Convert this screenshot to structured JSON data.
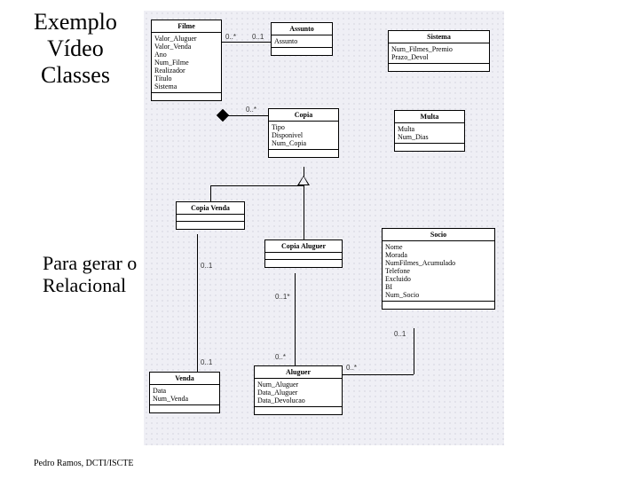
{
  "title_l1": "Exemplo",
  "title_l2": "Vídeo",
  "title_l3": "Classes",
  "subtitle_l1": "Para gerar o",
  "subtitle_l2": "Relacional",
  "footer": "Pedro Ramos, DCTI/ISCTE",
  "classes": {
    "filme": {
      "name": "Filme",
      "attrs": [
        "Valor_Aluguer",
        "Valor_Venda",
        "Ano",
        "Num_Filme",
        "Realizador",
        "Título",
        "Sistema"
      ]
    },
    "assunto": {
      "name": "Assunto",
      "attrs": [
        "Assunto"
      ]
    },
    "sistema": {
      "name": "Sistema",
      "attrs": [
        "Num_Filmes_Premio",
        "Prazo_Devol"
      ]
    },
    "copia": {
      "name": "Copia",
      "attrs": [
        "Tipo",
        "Disponivel",
        "Num_Copia"
      ]
    },
    "multa": {
      "name": "Multa",
      "attrs": [
        "Multa",
        "Num_Dias"
      ]
    },
    "copia_venda": {
      "name": "Copia Venda",
      "attrs": []
    },
    "copia_aluguer": {
      "name": "Copia Aluguer",
      "attrs": []
    },
    "socio": {
      "name": "Socio",
      "attrs": [
        "Nome",
        "Morada",
        "NumFilmes_Acumulado",
        "Telefone",
        "Excluido",
        "BI",
        "Num_Socio"
      ]
    },
    "venda": {
      "name": "Venda",
      "attrs": [
        "Data",
        "Num_Venda"
      ]
    },
    "aluguer": {
      "name": "Aluguer",
      "attrs": [
        "Num_Aluguer",
        "Data_Aluguer",
        "Data_Devolucao"
      ]
    }
  },
  "mult": {
    "filme_assunto_l": "0..*",
    "filme_assunto_r": "0..1",
    "filme_copia": "0..*",
    "copia_venda_venda": "0..1",
    "venda_copia_venda": "0..1",
    "aluguer_copia_aluguer": "0..*",
    "aluguer_aluguer": "0..1*",
    "socio_aluguer_l": "0..*",
    "socio_aluguer_r": "0..1"
  }
}
